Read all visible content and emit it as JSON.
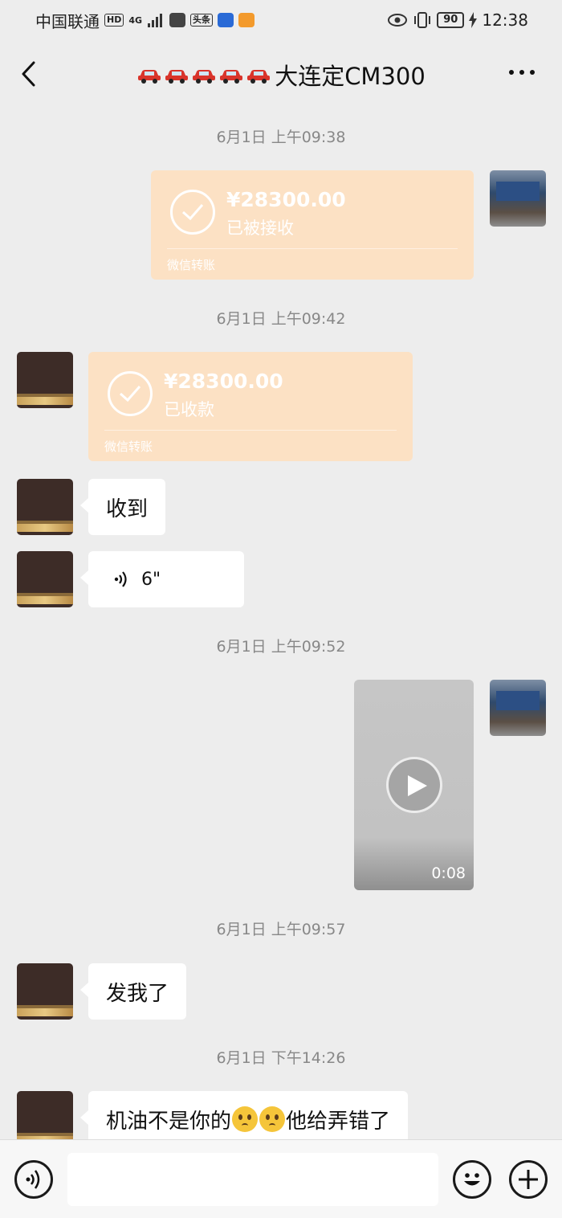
{
  "status_bar": {
    "carrier": "中国联通",
    "hd": "HD",
    "network": "4G",
    "app_badge": "头条",
    "battery": "90",
    "time": "12:38"
  },
  "header": {
    "title": "大连定CM300",
    "car_emoji_icon": "red-car-icon",
    "car_emoji_count": 5
  },
  "messages": {
    "ts1": "6月1日 上午09:38",
    "transfer1": {
      "amount": "¥28300.00",
      "status": "已被接收",
      "label": "微信转账"
    },
    "ts2": "6月1日 上午09:42",
    "transfer2": {
      "amount": "¥28300.00",
      "status": "已收款",
      "label": "微信转账"
    },
    "text1": "收到",
    "voice_duration": "6\"",
    "ts3": "6月1日 上午09:52",
    "video_duration": "0:08",
    "ts4": "6月1日 上午09:57",
    "text2": "发我了",
    "ts5": "6月1日 下午14:26",
    "text3_part1": "机油不是你的",
    "text3_part2": "他给弄错了",
    "emoji_icon": "pleading-face-icon"
  },
  "colors": {
    "background": "#ededed",
    "transfer_card": "#fce1c4",
    "bubble": "#ffffff"
  }
}
